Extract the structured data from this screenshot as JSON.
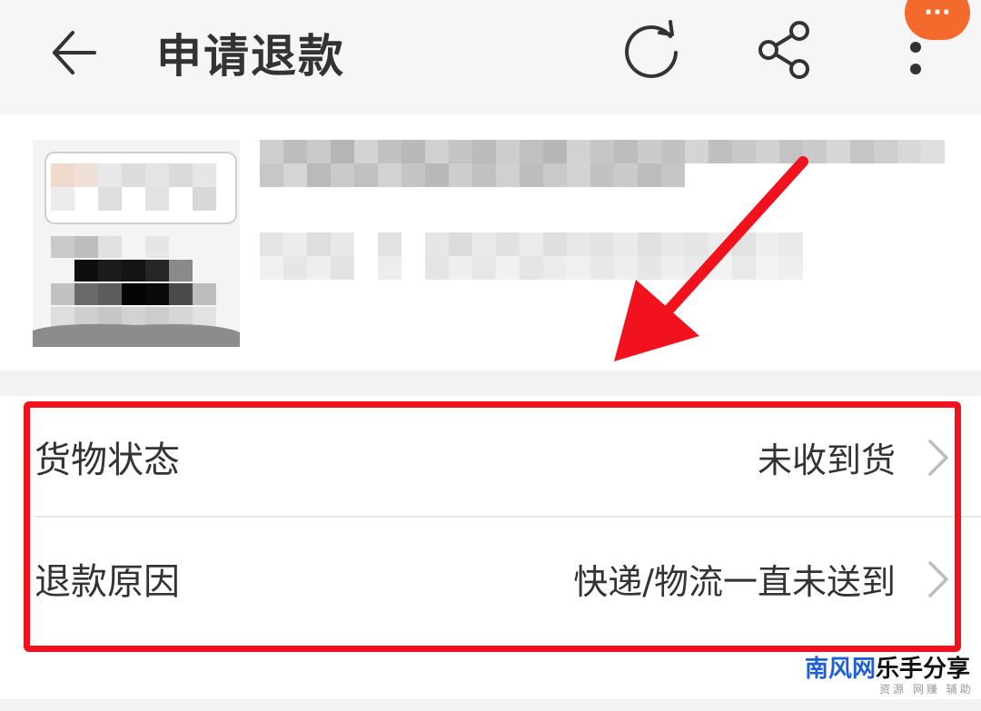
{
  "header": {
    "title": "申请退款",
    "back_icon": "arrow-left-icon",
    "refresh_icon": "refresh-icon",
    "share_icon": "share-icon",
    "more_icon": "more-vertical-icon",
    "floating_more_label": "···"
  },
  "product": {
    "image_state": "pixelated",
    "title_state": "pixelated"
  },
  "refund_form": {
    "rows": [
      {
        "label": "货物状态",
        "value": "未收到货"
      },
      {
        "label": "退款原因",
        "value": "快递/物流一直未送到"
      }
    ]
  },
  "annotation": {
    "highlight_color": "#f2121e",
    "arrow_color": "#f2121e"
  },
  "watermark": {
    "brand_blue": "南风网",
    "brand_black": "乐手分享",
    "subtitle": "资源 网赚 辅助",
    "brand_color": "#1f5fd6"
  }
}
